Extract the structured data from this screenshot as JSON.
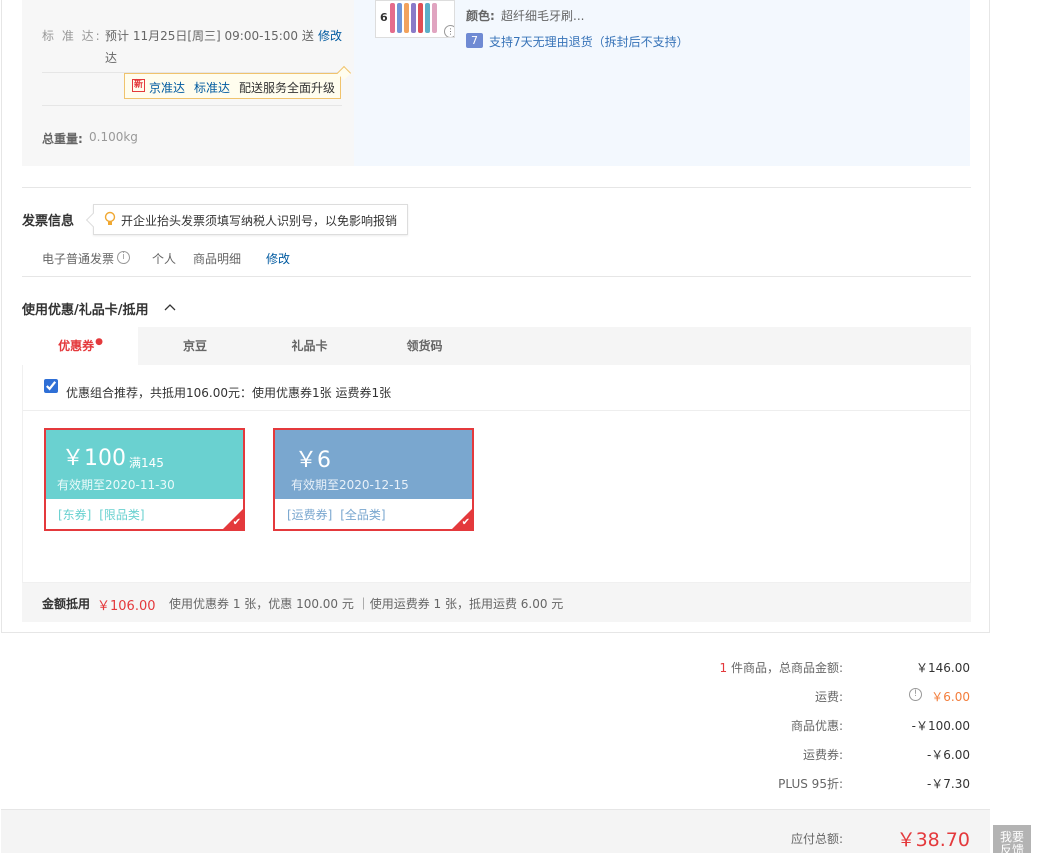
{
  "delivery": {
    "label": "标 准 达:",
    "schedule_line1": "预计 11月25日[周三] 09:00-15:00 送",
    "schedule_line2": "达",
    "modify": "修改",
    "badge_jd": "京准达",
    "badge_std": "标准达",
    "badge_text": "配送服务全面升级",
    "weight_label": "总重量:",
    "weight_value": "0.100kg"
  },
  "goods": {
    "color_label": "颜色:",
    "color_value": "超纤细毛牙刷...",
    "return_badge": "7",
    "return_text": "支持7天无理由退货（拆封后不支持）",
    "thumb_mark": "6"
  },
  "invoice": {
    "title": "发票信息",
    "tip": "开企业抬头发票须填写纳税人识别号，以免影响报销",
    "type": "电子普通发票",
    "person": "个人",
    "detail": "商品明细",
    "modify": "修改"
  },
  "discount": {
    "title": "使用优惠/礼品卡/抵用",
    "tabs": [
      "优惠券",
      "京豆",
      "礼品卡",
      "领货码"
    ],
    "recommend": "优惠组合推荐，共抵用106.00元：使用优惠券1张 运费券1张",
    "coupons": [
      {
        "amount": "￥100",
        "cond": "满145",
        "expiry": "有效期至2020-11-30",
        "tag1": "[东券]",
        "tag2": "[限品类]",
        "color": "#6ad1d0"
      },
      {
        "amount": "￥6",
        "cond": "",
        "expiry": "有效期至2020-12-15",
        "tag1": "[运费券]",
        "tag2": "[全品类]",
        "color": "#7aa7cf"
      }
    ],
    "summary_label": "金额抵用",
    "summary_amount": "￥106.00",
    "summary_detail": "使用优惠券 1 张，优惠 100.00 元 ｜使用运费券 1 张，抵用运费 6.00 元"
  },
  "totals": {
    "count": "1",
    "items_label": "件商品，总商品金额:",
    "items_value": "￥146.00",
    "shipping_label": "运费:",
    "shipping_value": "￥6.00",
    "discount_label": "商品优惠:",
    "discount_value": "-￥100.00",
    "shipcoupon_label": "运费券:",
    "shipcoupon_value": "-￥6.00",
    "plus_label": "PLUS 95折:",
    "plus_value": "-￥7.30",
    "payable_label": "应付总额:",
    "payable_value": "￥38.70"
  },
  "feedback": {
    "line1": "我要",
    "line2": "反馈"
  }
}
